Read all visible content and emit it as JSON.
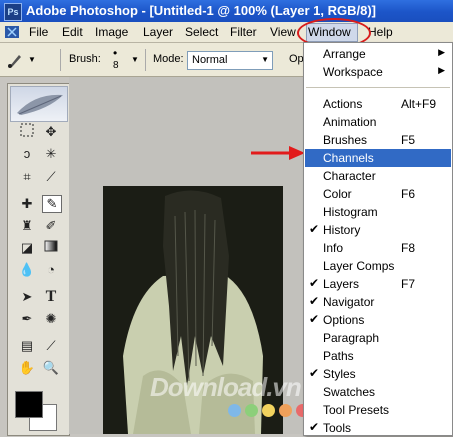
{
  "window": {
    "title": "Adobe Photoshop - [Untitled-1 @ 100% (Layer 1, RGB/8)]"
  },
  "menubar": {
    "items": [
      {
        "label": "File"
      },
      {
        "label": "Edit"
      },
      {
        "label": "Image"
      },
      {
        "label": "Layer"
      },
      {
        "label": "Select"
      },
      {
        "label": "Filter"
      },
      {
        "label": "View"
      },
      {
        "label": "Window"
      },
      {
        "label": "Help"
      }
    ]
  },
  "options_bar": {
    "brush_label": "Brush:",
    "brush_size": "8",
    "mode_label": "Mode:",
    "mode_value": "Normal",
    "opacity_label": "Op"
  },
  "colors": {
    "highlight": "#316ac5",
    "annotation_red": "#d81c1c",
    "titlebar": "#1c55c8"
  },
  "window_menu": {
    "groups": [
      [
        {
          "label": "Arrange",
          "submenu": true
        },
        {
          "label": "Workspace",
          "submenu": true
        }
      ],
      [
        {
          "label": "Actions",
          "shortcut": "Alt+F9"
        },
        {
          "label": "Animation"
        },
        {
          "label": "Brushes",
          "shortcut": "F5"
        },
        {
          "label": "Channels",
          "highlighted": true
        },
        {
          "label": "Character"
        },
        {
          "label": "Color",
          "shortcut": "F6"
        },
        {
          "label": "Histogram"
        },
        {
          "label": "History",
          "checked": true
        },
        {
          "label": "Info",
          "shortcut": "F8"
        },
        {
          "label": "Layer Comps"
        },
        {
          "label": "Layers",
          "shortcut": "F7",
          "checked": true
        },
        {
          "label": "Navigator",
          "checked": true
        },
        {
          "label": "Options",
          "checked": true
        },
        {
          "label": "Paragraph"
        },
        {
          "label": "Paths"
        },
        {
          "label": "Styles",
          "checked": true
        },
        {
          "label": "Swatches"
        },
        {
          "label": "Tool Presets"
        },
        {
          "label": "Tools",
          "checked": true
        }
      ]
    ]
  },
  "watermark": {
    "text": "Download.vn"
  }
}
